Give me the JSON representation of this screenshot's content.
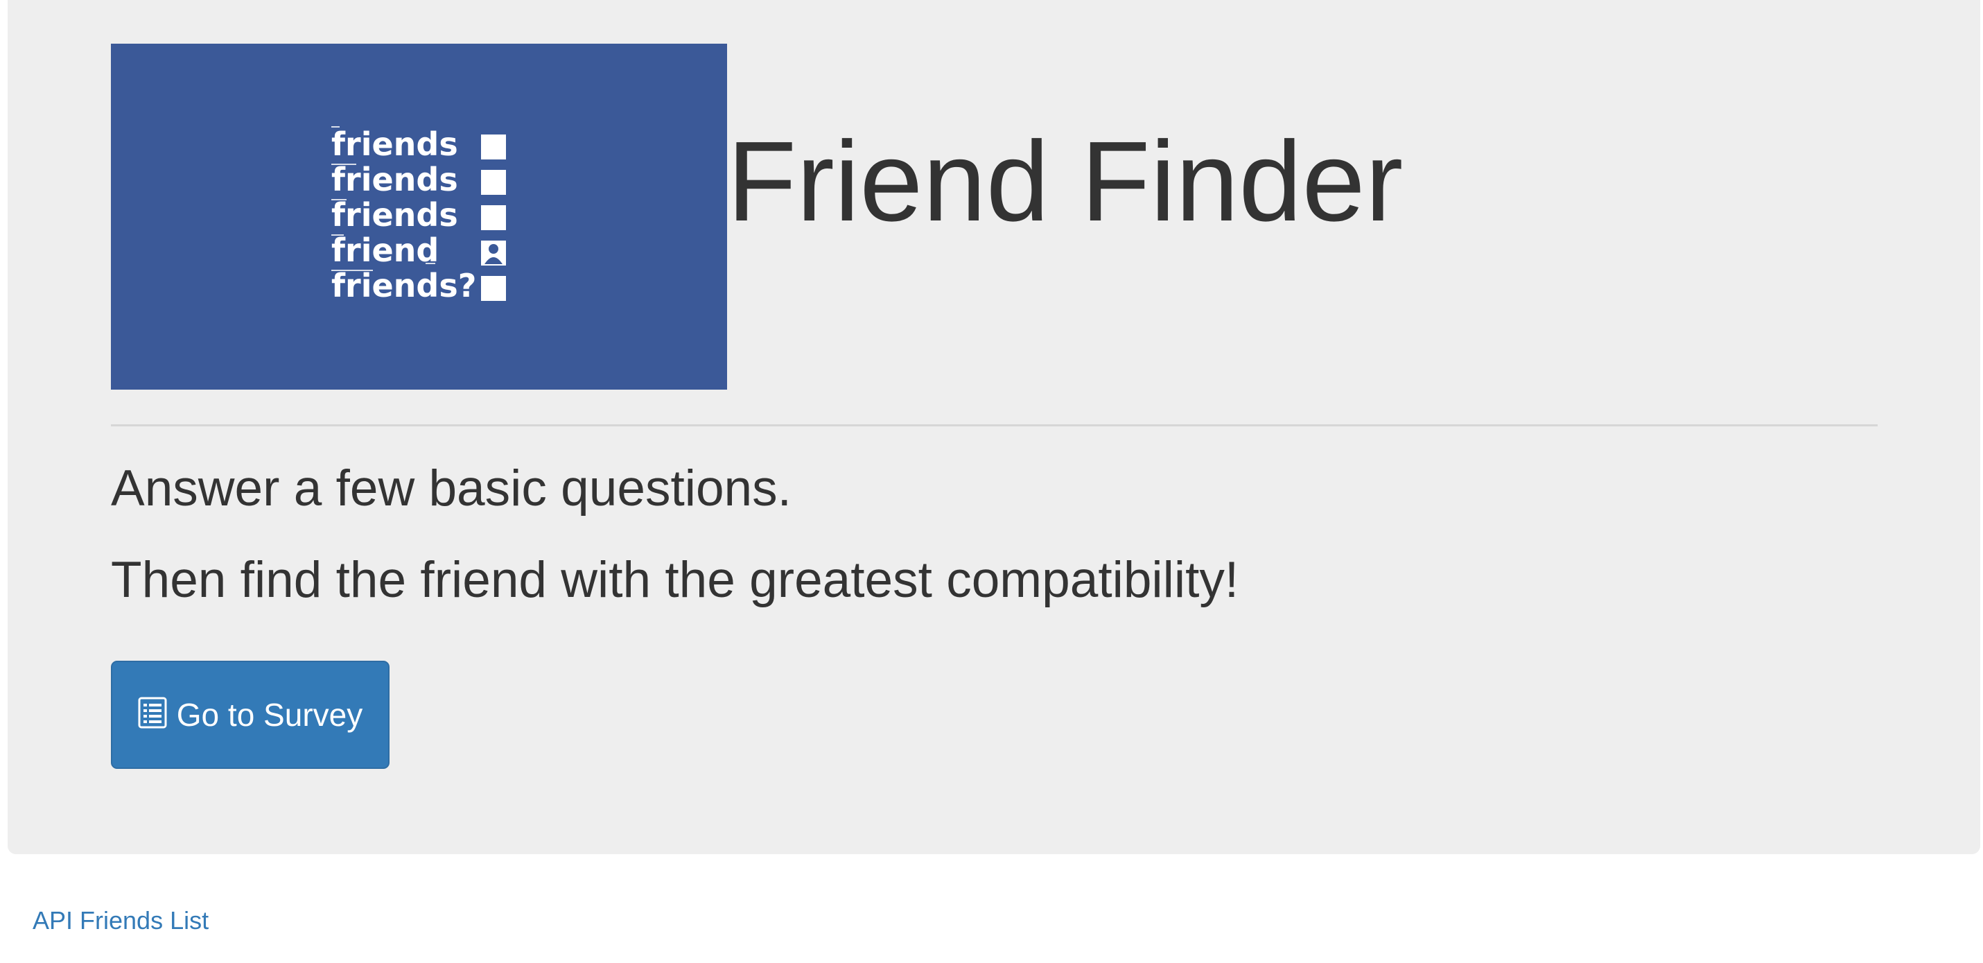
{
  "colors": {
    "jumbotron_background": "#eeeeee",
    "image_background": "#3b5998",
    "primary_button": "#337ab7",
    "link": "#337ab7",
    "text": "#333333"
  },
  "hero": {
    "image": {
      "words": [
        "friends",
        "friends",
        "friends",
        "friend",
        "friends?"
      ],
      "checkbox_icons": [
        "empty-checkbox-icon",
        "empty-checkbox-icon",
        "empty-checkbox-icon",
        "person-checkbox-icon",
        "empty-checkbox-icon"
      ]
    },
    "title": "Friend Finder"
  },
  "main": {
    "lead_1": "Answer a few basic questions.",
    "lead_2": "Then find the friend with the greatest compatibility!",
    "survey_button": {
      "label": "Go to Survey",
      "icon": "list-alt-icon"
    }
  },
  "footer": {
    "api_link": "API Friends List"
  }
}
